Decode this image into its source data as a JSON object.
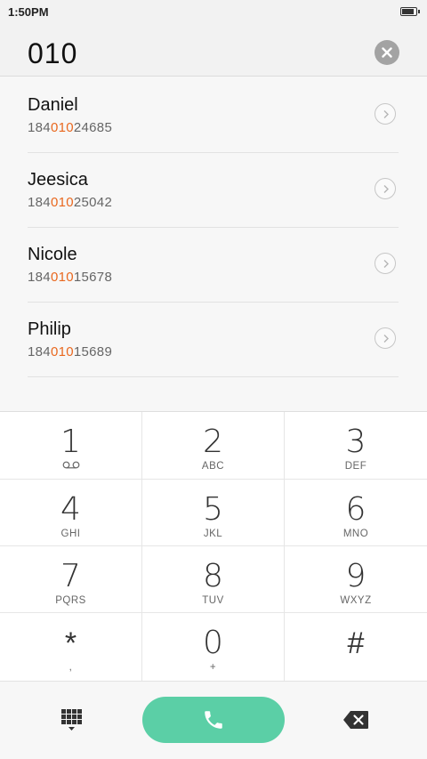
{
  "status_bar": {
    "time": "1:50PM",
    "battery_level": 0.9
  },
  "dialer": {
    "number": "010"
  },
  "results": [
    {
      "name": "Daniel",
      "number_prefix": "184",
      "number_match": "010",
      "number_suffix": "24685"
    },
    {
      "name": "Jeesica",
      "number_prefix": "184",
      "number_match": "010",
      "number_suffix": "25042"
    },
    {
      "name": "Nicole",
      "number_prefix": "184",
      "number_match": "010",
      "number_suffix": "15678"
    },
    {
      "name": "Philip",
      "number_prefix": "184",
      "number_match": "010",
      "number_suffix": "15689"
    }
  ],
  "keypad": [
    {
      "digit": "1",
      "letters": ""
    },
    {
      "digit": "2",
      "letters": "ABC"
    },
    {
      "digit": "3",
      "letters": "DEF"
    },
    {
      "digit": "4",
      "letters": "GHI"
    },
    {
      "digit": "5",
      "letters": "JKL"
    },
    {
      "digit": "6",
      "letters": "MNO"
    },
    {
      "digit": "7",
      "letters": "PQRS"
    },
    {
      "digit": "8",
      "letters": "TUV"
    },
    {
      "digit": "9",
      "letters": "WXYZ"
    },
    {
      "digit": "*",
      "letters": ","
    },
    {
      "digit": "0",
      "letters": "+"
    },
    {
      "digit": "#",
      "letters": ""
    }
  ],
  "icons": {
    "voicemail": "voicemail-icon",
    "clear": "clear-icon",
    "detail": "chevron-right-icon",
    "keypad_toggle": "dialpad-icon",
    "call": "phone-icon",
    "backspace": "backspace-icon"
  },
  "colors": {
    "accent": "#5bcfa6",
    "highlight": "#e9681f"
  }
}
